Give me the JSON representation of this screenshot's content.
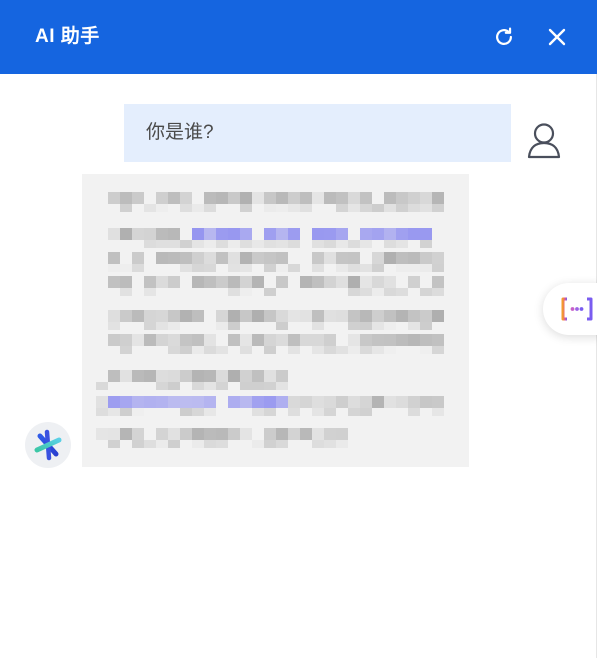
{
  "header": {
    "title": "AI 助手",
    "refresh_icon": "refresh-icon",
    "close_icon": "close-icon",
    "color": "#1565e0"
  },
  "conversation": {
    "user_message": "你是谁?",
    "user_avatar_icon": "user-outline-icon",
    "assistant_avatar_icon": "assistant-logo-icon",
    "assistant_reply_obscured": true,
    "user_bubble_color": "#e4eefd",
    "assistant_bubble_color": "#f2f2f2"
  },
  "side_widget": {
    "icon": "chat-bracket-dots-icon"
  }
}
